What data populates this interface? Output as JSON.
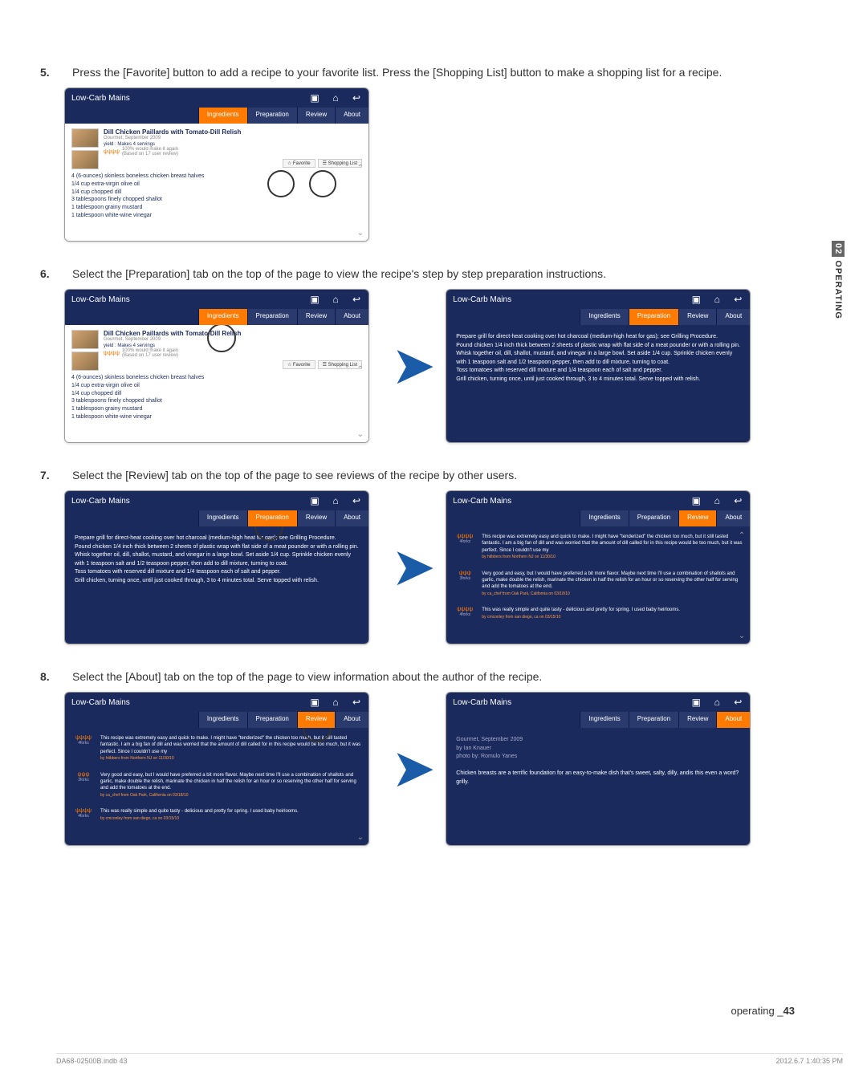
{
  "sidetab": {
    "num": "02",
    "label": "OPERATING"
  },
  "steps": {
    "s5": {
      "num": "5.",
      "text": "Press the [Favorite] button to add a recipe to your favorite list. Press the [Shopping List] button to make a shopping list for a recipe."
    },
    "s6": {
      "num": "6.",
      "text": "Select the [Preparation] tab on the top of the page to view the recipe's step by step preparation instructions."
    },
    "s7": {
      "num": "7.",
      "text": "Select the [Review] tab on the top of the page to see reviews of the recipe by other users."
    },
    "s8": {
      "num": "8.",
      "text": "Select the [About] tab on the top of the page to view information about the author of the recipe."
    }
  },
  "app": {
    "title": "Low-Carb Mains",
    "tabs": {
      "ingredients": "Ingredients",
      "preparation": "Preparation",
      "review": "Review",
      "about": "About"
    },
    "recipe": {
      "title": "Dill Chicken Paillards with Tomato-Dill Relish",
      "source": "Gourmet, September 2009",
      "yield": "yield : Makes 4 servings",
      "rating": "100% would make it again",
      "rating_sub": "(Based on 17 user review)",
      "favorite": "Favorite",
      "shopping": "Shopping List"
    },
    "ingredients": [
      "4 (6-ounces) skinless boneless chicken breast halves",
      "1/4 cup extra-virgin olive oil",
      "1/4 cup chopped dill",
      "3 tablespoons finely chopped shallot",
      "1 tablespoon grainy mustard",
      "1 tablespoon white-wine vinegar"
    ],
    "preparation": "Prepare grill for direct-heat cooking over hot charcoal (medium-high heat for gas); see Grilling Procedure.\nPound chicken 1/4 inch thick between 2 sheets of plastic wrap with flat side of a meat pounder or with a rolling pin.\nWhisk together oil, dill, shallot, mustard, and vinegar in a large bowl. Set aside 1/4 cup. Sprinkle chicken evenly with 1 teaspoon salt and 1/2 teaspoon pepper, then add to dill mixture, turning to coat.\nToss tomatoes with reserved dill mixture and 1/4 teaspoon each of salt and pepper.\nGrill chicken, turning once, until just cooked through, 3 to 4 minutes total. Serve topped with relish.",
    "reviews": [
      {
        "forks": "4forks",
        "text": "This recipe was extremely easy and quick to make. I might have \"tenderized\" the chicken too much, but it still tasted fantastic. I am a big fan of dill and was worried that the amount of dill called for in this recipe would be too much, but it was perfect. Since I couldn't use my",
        "by": "by htibbers from Northern NJ on 11/30/10"
      },
      {
        "forks": "3forks",
        "text": "Very good and easy, but I would have preferred a bit more flavor. Maybe next time I'll use a combination of shallots and garlic, make double the relish, marinate the chicken in half the relish for an hour or so reserving the other half for serving and add the tomatoes at the end.",
        "by": "by ca_chef from Oak Park, California on 03/18/10"
      },
      {
        "forks": "4forks",
        "text": "This was really simple and quite tasty - delicious and pretty for spring. I used baby heirlooms.",
        "by": "by cmconley from san diego, ca on 03/15/10"
      }
    ],
    "about": {
      "line1": "Gourmet, September 2009",
      "line2": "by Ian Knauer",
      "line3": "photo by: Romulo Yanes",
      "desc": "Chicken breasts are a terrific foundation for an easy-to-make dish that's sweet, salty, dilly, andis this even a word?grilly."
    }
  },
  "footer": {
    "label": "operating _",
    "page": "43"
  },
  "indb": {
    "file": "DA68-02500B.indb   43",
    "date": "2012.6.7   1:40:35 PM"
  }
}
